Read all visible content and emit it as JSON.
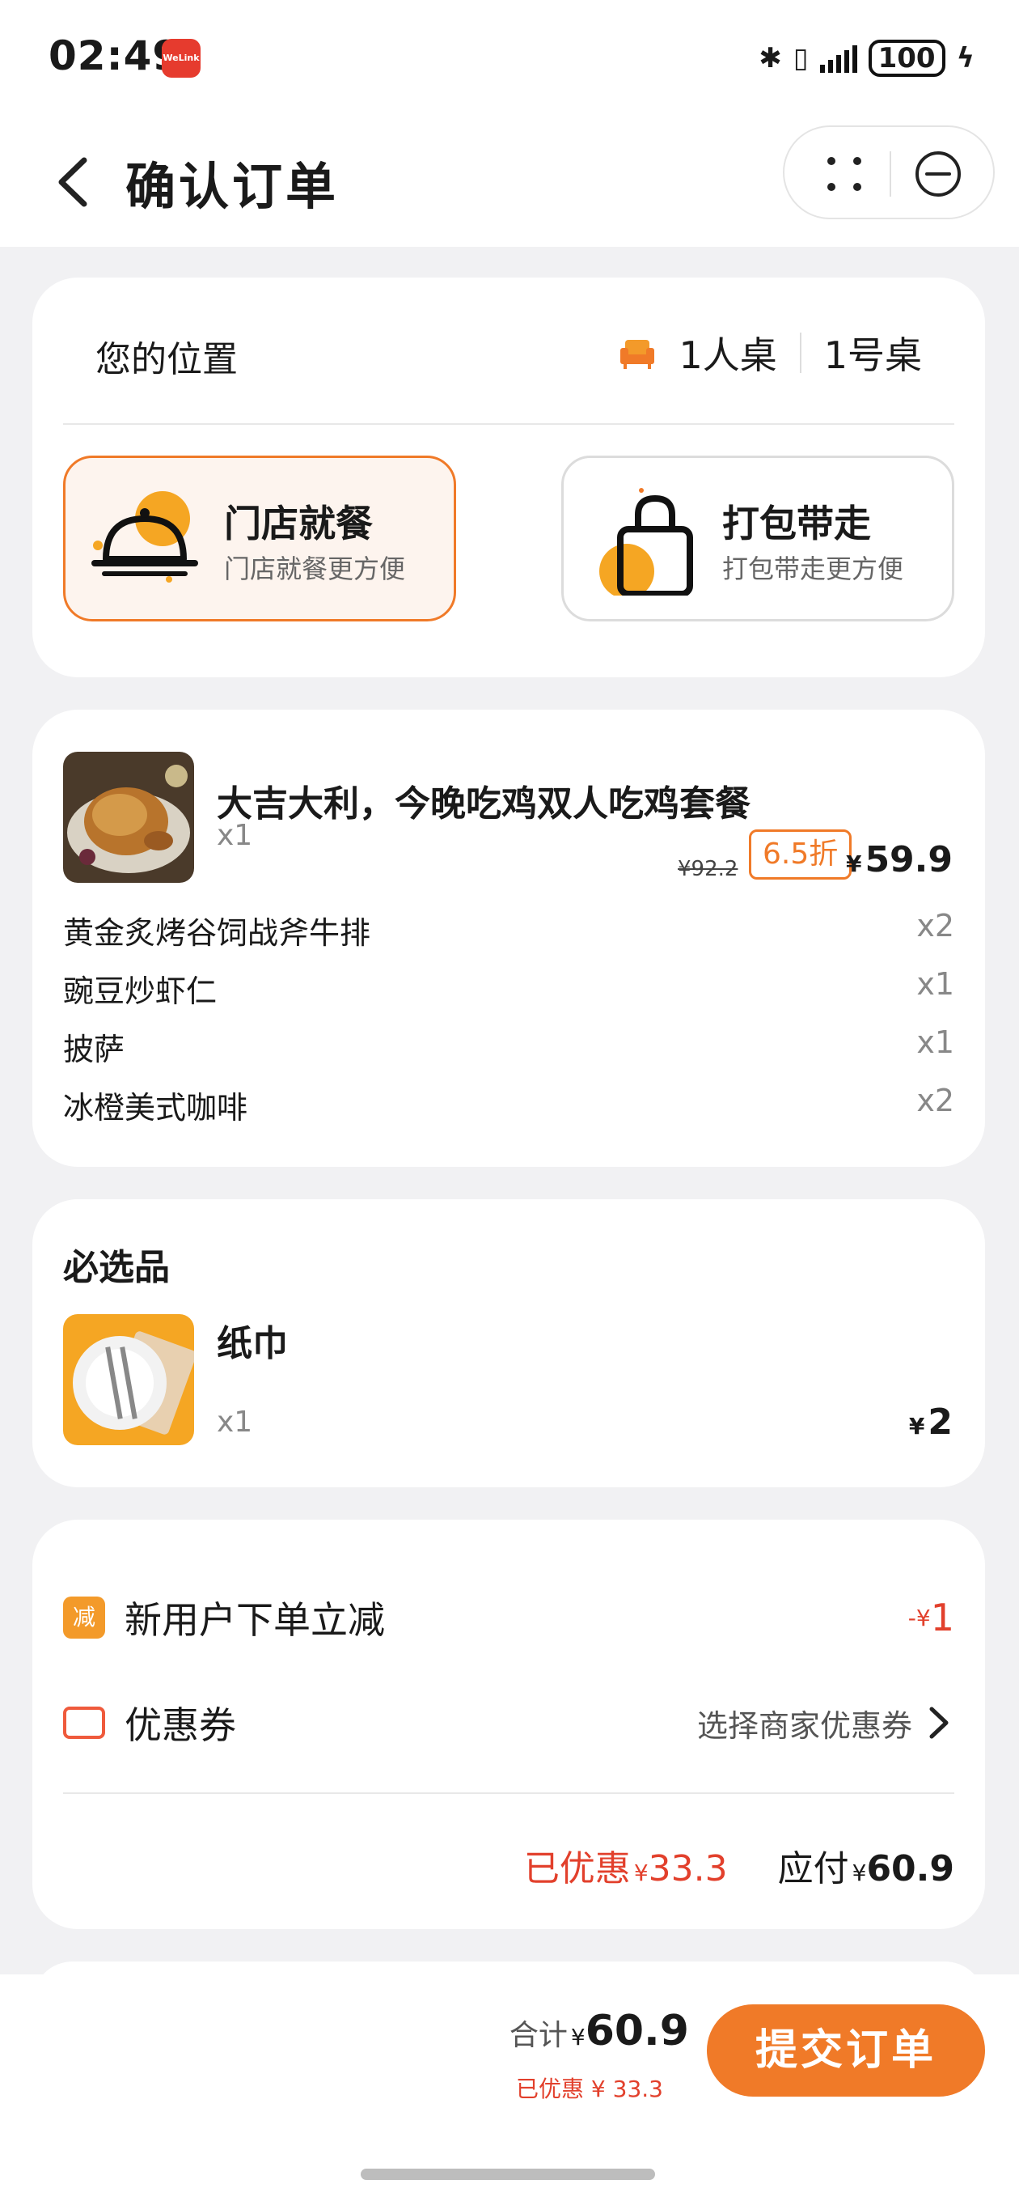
{
  "status_bar": {
    "time": "02:49",
    "app_badge": "WeLink",
    "battery": "100"
  },
  "nav": {
    "title": "确认订单",
    "icons": [
      "back-icon",
      "more-dots-icon",
      "close-circle-icon"
    ]
  },
  "location": {
    "label": "您的位置",
    "table_type": "1人桌",
    "table_no": "1号桌",
    "modes": [
      {
        "title": "门店就餐",
        "subtitle": "门店就餐更方便",
        "active": true
      },
      {
        "title": "打包带走",
        "subtitle": "打包带走更方便",
        "active": false
      }
    ]
  },
  "product": {
    "title": "大吉大利，今晚吃鸡双人吃鸡套餐",
    "qty": "x1",
    "original_price": "¥92.2",
    "discount": "6.5折",
    "currency": "¥",
    "price": "59.9",
    "items": [
      {
        "name": "黄金炙烤谷饲战斧牛排",
        "qty": "x2"
      },
      {
        "name": "豌豆炒虾仁",
        "qty": "x1"
      },
      {
        "name": "披萨",
        "qty": "x1"
      },
      {
        "name": "冰橙美式咖啡",
        "qty": "x2"
      }
    ]
  },
  "required": {
    "title": "必选品",
    "name": "纸巾",
    "qty": "x1",
    "currency": "¥",
    "price": "2"
  },
  "promotions": {
    "new_user_badge": "减",
    "new_user_label": "新用户下单立减",
    "new_user_amount_prefix": "-¥",
    "new_user_amount": "1",
    "coupon_label": "优惠券",
    "coupon_action": "选择商家优惠券",
    "saved_label": "已优惠",
    "saved_currency": "¥",
    "saved_amount": "33.3",
    "payable_label": "应付",
    "payable_currency": "¥",
    "payable_amount": "60.9"
  },
  "bottom": {
    "total_label": "合计",
    "total_currency": "¥",
    "total_amount": "60.9",
    "saved_text": "已优惠 ¥ 33.3",
    "submit_label": "提交订单"
  },
  "colors": {
    "accent": "#f07a28",
    "discount_red": "#e2402c",
    "page_bg": "#f1f1f3"
  }
}
